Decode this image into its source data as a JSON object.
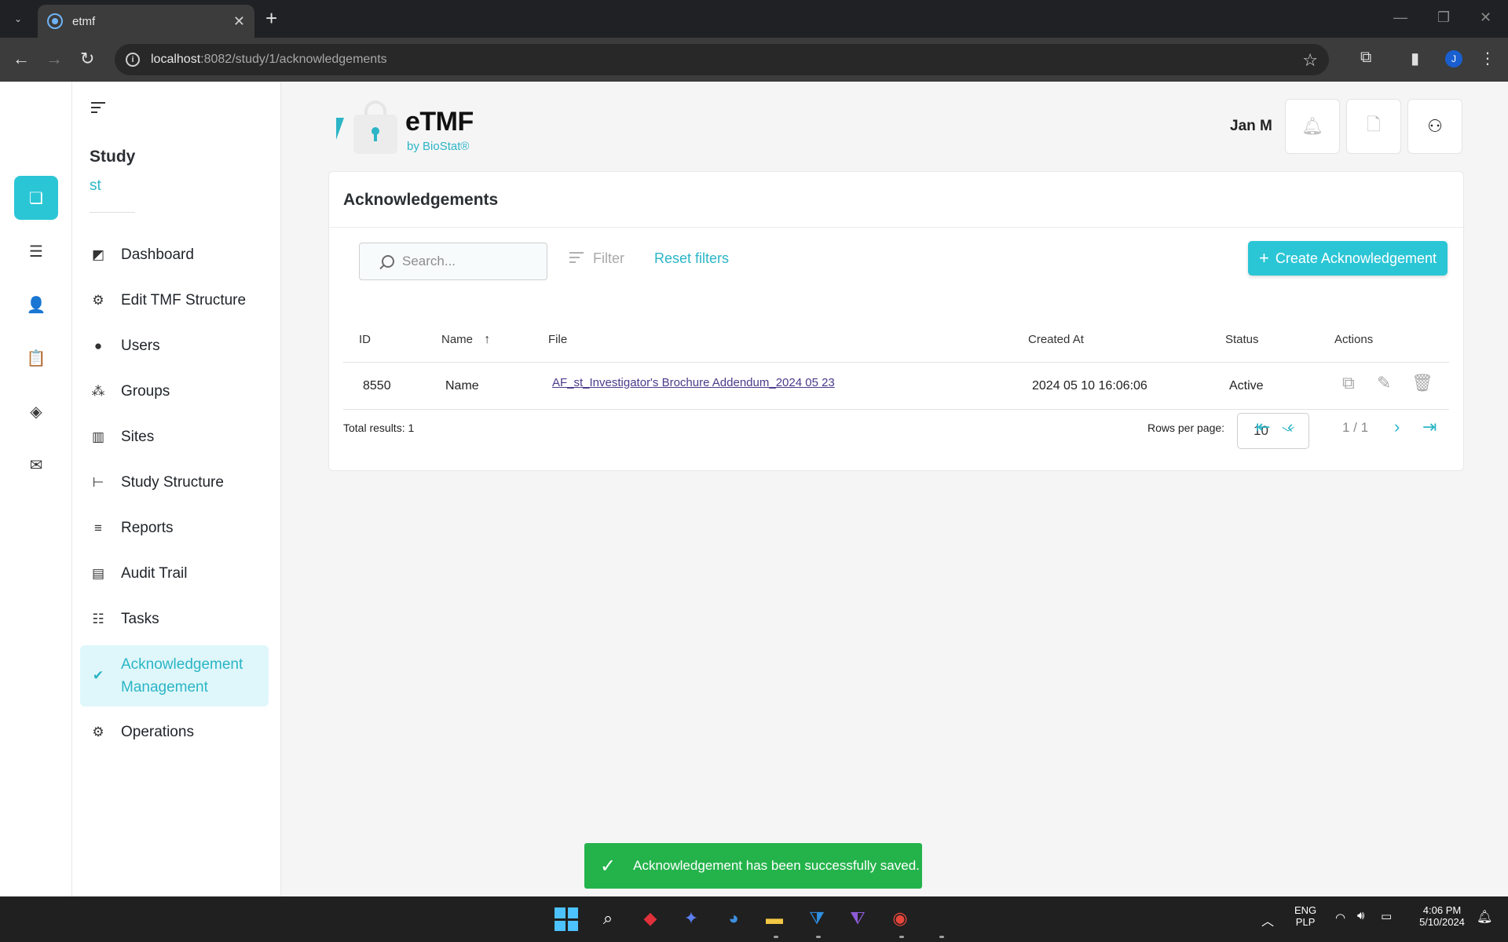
{
  "browser": {
    "tab_title": "etmf",
    "url_host": "localhost",
    "url_path": ":8082/study/1/acknowledgements",
    "profile_initial": "J"
  },
  "sidebar": {
    "study_label": "Study",
    "study_name": "st",
    "items": [
      {
        "label": "Dashboard",
        "icon": "dashboard-icon"
      },
      {
        "label": "Edit TMF Structure",
        "icon": "gear-icon"
      },
      {
        "label": "Users",
        "icon": "user-icon"
      },
      {
        "label": "Groups",
        "icon": "group-icon"
      },
      {
        "label": "Sites",
        "icon": "building-icon"
      },
      {
        "label": "Study Structure",
        "icon": "tree-icon"
      },
      {
        "label": "Reports",
        "icon": "report-icon"
      },
      {
        "label": "Audit Trail",
        "icon": "clipboard-icon"
      },
      {
        "label": "Tasks",
        "icon": "task-list-icon"
      },
      {
        "label": "Acknowledgement Management",
        "icon": "clipboard-check-icon",
        "active": true
      },
      {
        "label": "Operations",
        "icon": "gears-icon"
      }
    ]
  },
  "header": {
    "logo_title": "eTMF",
    "logo_subtitle": "by BioStat®",
    "username": "Jan M"
  },
  "page": {
    "title": "Acknowledgements",
    "search_placeholder": "Search...",
    "filter_label": "Filter",
    "reset_label": "Reset filters",
    "create_label": "Create Acknowledgement"
  },
  "table": {
    "columns": [
      "ID",
      "Name",
      "File",
      "Created At",
      "Status",
      "Actions"
    ],
    "rows": [
      {
        "id": "8550",
        "name": "Name",
        "file": "AF_st_Investigator's Brochure Addendum_2024 05 23",
        "created_at": "2024 05 10 16:06:06",
        "status": "Active"
      }
    ],
    "total_results": "Total results: 1",
    "rows_per_page_label": "Rows per page:",
    "rows_per_page": "10",
    "page_indicator": "1 / 1"
  },
  "toast": {
    "message": "Acknowledgement has been successfully saved."
  },
  "taskbar": {
    "lang_top": "ENG",
    "lang_bottom": "PLP",
    "time": "4:06 PM",
    "date": "5/10/2024"
  },
  "colors": {
    "accent": "#2bc6d6",
    "success": "#24b34b",
    "link": "#4b3a8a"
  }
}
